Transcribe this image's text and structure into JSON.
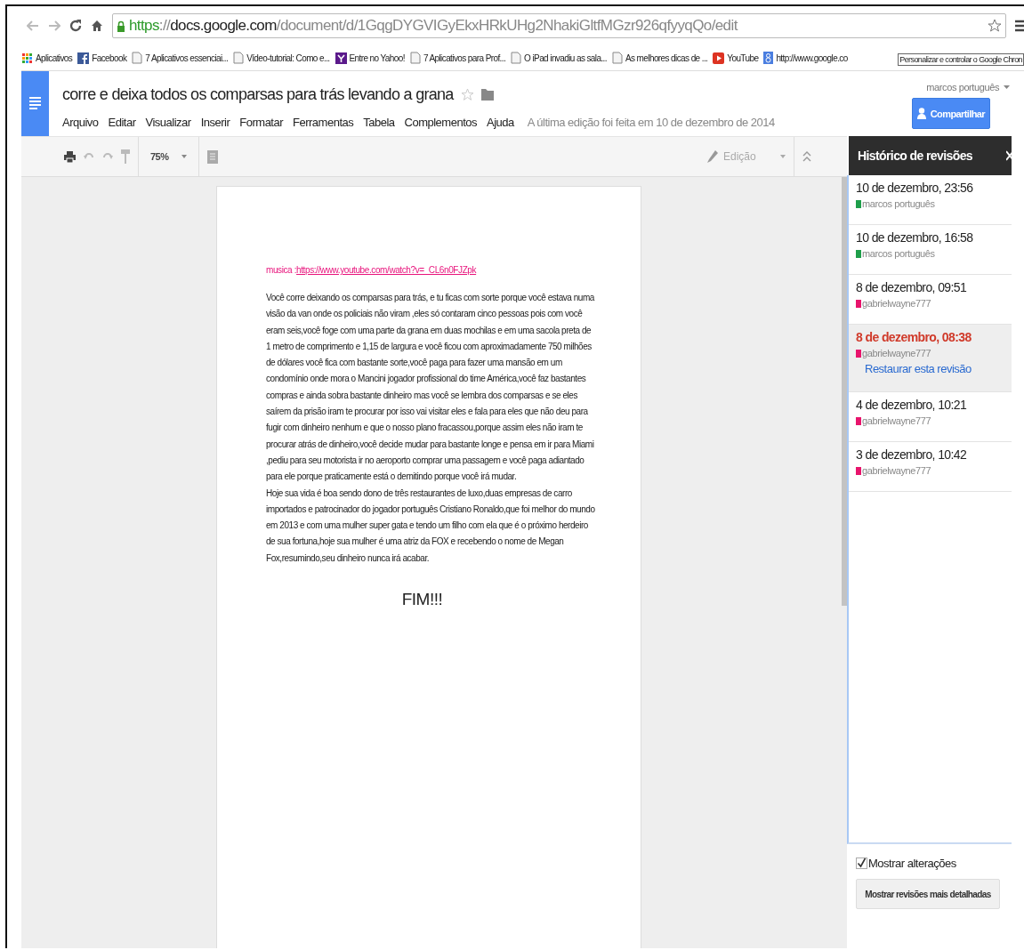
{
  "browser": {
    "url": [
      {
        "text": "https",
        "kind": "scheme"
      },
      {
        "text": "://",
        "kind": "plain"
      },
      {
        "text": "docs.google.com",
        "kind": "host"
      },
      {
        "text": "/document/d/1GqgDYGVIGyEkxHRkUHg2NhakiGltfMGzr926qfyyqQo/edit",
        "kind": "plain"
      }
    ],
    "bookmarks": [
      {
        "label": "Aplicativos",
        "kind": "apps"
      },
      {
        "label": "Facebook",
        "kind": "facebook"
      },
      {
        "label": "7 Aplicativos essenciai...",
        "kind": "page"
      },
      {
        "label": "Vídeo-tutorial: Como e...",
        "kind": "page"
      },
      {
        "label": "Entre no Yahoo!",
        "kind": "yahoo"
      },
      {
        "label": "7 Aplicativos para Prof...",
        "kind": "page"
      },
      {
        "label": "O iPad invadiu as sala...",
        "kind": "page"
      },
      {
        "label": "As melhores dicas de ...",
        "kind": "page"
      },
      {
        "label": "YouTube",
        "kind": "youtube"
      },
      {
        "label": "http://www.google.co",
        "kind": "google"
      }
    ],
    "tooltip": "Personalizar e controlar o Google Chron"
  },
  "document": {
    "title": "corre e deixa todos os comparsas para trás levando a grana",
    "menu": [
      "Arquivo",
      "Editar",
      "Visualizar",
      "Inserir",
      "Formatar",
      "Ferramentas",
      "Tabela",
      "Complementos",
      "Ajuda"
    ],
    "last_edit": "A última edição foi feita em 10 de dezembro de 2014",
    "user": "marcos português",
    "share_button": "Compartilhar",
    "toolbar": {
      "zoom": "75%",
      "mode": "Edição"
    },
    "body": {
      "music_label": "musica :",
      "music_link": "https://www.youtube.com/watch?v=_CL6n0FJZpk",
      "paragraphs": [
        "Você corre deixando os comparsas para trás, e tu ficas com sorte porque você estava numa visão da van onde os policiais não viram ,eles só contaram cinco pessoas pois com você eram seis,você foge com uma parte da grana em duas mochilas e em uma sacola preta de 1 metro de comprimento e 1,15 de largura e você ficou com aproximadamente 750 milhões de dólares você fica com bastante sorte,você paga para fazer uma mansão em um condomínio onde mora o Mancini jogador profissional do time América,você faz bastantes compras e ainda sobra bastante dinheiro mas você se lembra dos comparsas e se eles saírem da prisão iram te procurar por isso vai visitar eles e fala para eles que não deu para fugir com dinheiro nenhum e que o nosso plano fracassou,porque assim eles não iram te procurar atrás de dinheiro,você decide mudar para bastante longe e pensa em ir para Miami ,pediu para seu motorista ir no aeroporto comprar uma passagem e você paga adiantado para ele porque praticamente está o demitindo porque você irá mudar.",
        "Hoje sua vida é boa sendo dono de três restaurantes de luxo,duas empresas de carro importados e patrocinador do jogador português Cristiano Ronaldo,que foi melhor do mundo em 2013 e com uma mulher super gata e tendo um filho com ela que é o próximo herdeiro de sua fortuna,hoje sua mulher é uma atriz da FOX e recebendo o nome de Megan Fox,resumindo,seu dinheiro nunca irá acabar."
      ],
      "ending": "FIM!!!"
    }
  },
  "revisions": {
    "title": "Histórico de revisões",
    "items": [
      {
        "date": "10 de dezembro, 23:56",
        "author": "marcos português",
        "color": "#1e9e4a",
        "selected": false
      },
      {
        "date": "10 de dezembro, 16:58",
        "author": "marcos português",
        "color": "#1e9e4a",
        "selected": false
      },
      {
        "date": "8 de dezembro, 09:51",
        "author": "gabrielwayne777",
        "color": "#e8146c",
        "selected": false
      },
      {
        "date": "8 de dezembro, 08:38",
        "author": "gabrielwayne777",
        "color": "#e8146c",
        "selected": true,
        "restore": "Restaurar esta revisão"
      },
      {
        "date": "4 de dezembro, 10:21",
        "author": "gabrielwayne777",
        "color": "#e8146c",
        "selected": false
      },
      {
        "date": "3 de dezembro, 10:42",
        "author": "gabrielwayne777",
        "color": "#e8146c",
        "selected": false
      }
    ],
    "show_changes": {
      "label": "Mostrar alterações",
      "checked": true
    },
    "detail_button": "Mostrar revisões mais detalhadas"
  }
}
